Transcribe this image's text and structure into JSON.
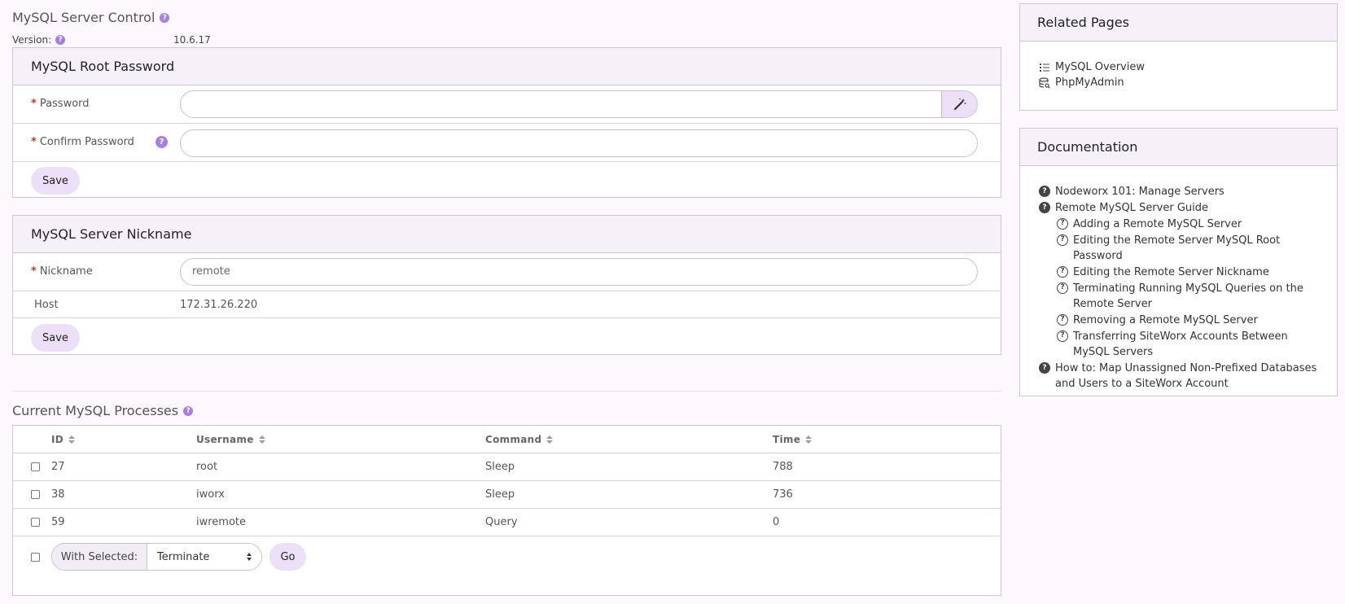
{
  "page": {
    "title": "MySQL Server Control",
    "version_label": "Version:",
    "version_value": "10.6.17"
  },
  "root_password": {
    "title": "MySQL Root Password",
    "password_label": "Password",
    "confirm_label": "Confirm Password",
    "password_value": "",
    "confirm_value": "",
    "save_label": "Save"
  },
  "nickname_panel": {
    "title": "MySQL Server Nickname",
    "nickname_label": "Nickname",
    "nickname_value": "remote",
    "host_label": "Host",
    "host_value": "172.31.26.220",
    "save_label": "Save"
  },
  "processes": {
    "title": "Current MySQL Processes",
    "columns": [
      "ID",
      "Username",
      "Command",
      "Time"
    ],
    "rows": [
      {
        "id": "27",
        "username": "root",
        "command": "Sleep",
        "time": "788"
      },
      {
        "id": "38",
        "username": "iworx",
        "command": "Sleep",
        "time": "736"
      },
      {
        "id": "59",
        "username": "iwremote",
        "command": "Query",
        "time": "0"
      }
    ],
    "with_selected_label": "With Selected:",
    "action_value": "Terminate",
    "go_label": "Go"
  },
  "related": {
    "title": "Related Pages",
    "items": [
      "MySQL Overview",
      "PhpMyAdmin"
    ]
  },
  "docs": {
    "title": "Documentation",
    "items": [
      {
        "label": "Nodeworx 101: Manage Servers",
        "level": 0
      },
      {
        "label": "Remote MySQL Server Guide",
        "level": 0
      },
      {
        "label": "Adding a Remote MySQL Server",
        "level": 1
      },
      {
        "label": "Editing the Remote Server MySQL Root Password",
        "level": 1
      },
      {
        "label": "Editing the Remote Server Nickname",
        "level": 1
      },
      {
        "label": "Terminating Running MySQL Queries on the Remote Server",
        "level": 1
      },
      {
        "label": "Removing a Remote MySQL Server",
        "level": 1
      },
      {
        "label": "Transferring SiteWorx Accounts Between MySQL Servers",
        "level": 1
      },
      {
        "label": "How to: Map Unassigned Non-Prefixed Databases and Users to a SiteWorx Account",
        "level": 0
      }
    ]
  },
  "colors": {
    "accent": "#a77ee6",
    "button_bg": "#ebe0f7",
    "panel_head_bg": "#f6f1f8",
    "border": "#cfc6d4"
  },
  "icons": {
    "help": "help-circle-icon",
    "wand": "magic-wand-icon",
    "list": "list-icon",
    "db": "database-search-icon"
  }
}
